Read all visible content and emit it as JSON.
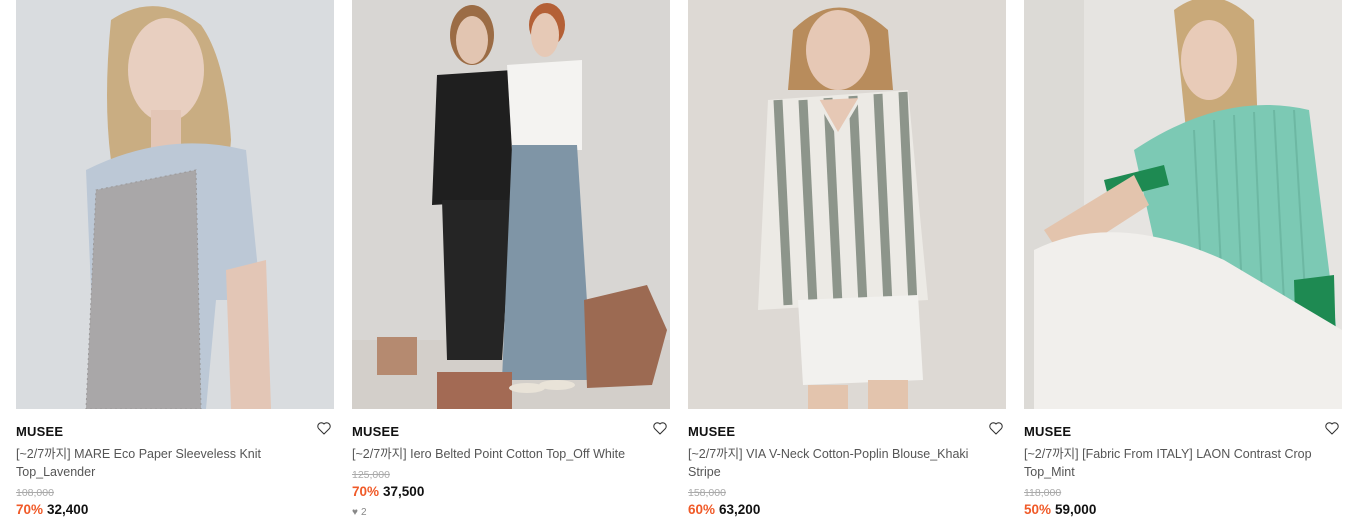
{
  "products": [
    {
      "brand": "MUSEE",
      "title": "[~2/7까지] MARE Eco Paper Sleeveless Knit Top_Lavender",
      "original_price": "108,000",
      "discount": "70%",
      "price": "32,400",
      "image_icon": "model-photo",
      "colors": {
        "bg": "#d9dcdf",
        "garment": "#a9a7a8",
        "tee": "#bcc8d6"
      }
    },
    {
      "brand": "MUSEE",
      "title": "[~2/7까지] Iero Belted Point Cotton Top_Off White",
      "original_price": "125,000",
      "discount": "70%",
      "price": "37,500",
      "likes": "2",
      "image_icon": "model-photo",
      "colors": {
        "bg": "#d8d6d3",
        "garment": "#1f1f1f",
        "skirt": "#7f95a6"
      }
    },
    {
      "brand": "MUSEE",
      "title": "[~2/7까지] VIA V-Neck Cotton-Poplin Blouse_Khaki Stripe",
      "original_price": "158,000",
      "discount": "60%",
      "price": "63,200",
      "image_icon": "model-photo",
      "colors": {
        "bg": "#ddd9d4",
        "garment": "#9ea59c",
        "shorts": "#f2f1ee"
      }
    },
    {
      "brand": "MUSEE",
      "title": "[~2/7까지] [Fabric From ITALY] LAON Contrast Crop Top_Mint",
      "original_price": "118,000",
      "discount": "50%",
      "price": "59,000",
      "image_icon": "model-photo",
      "colors": {
        "bg": "#e6e4e1",
        "garment": "#7cc9b4",
        "pants": "#f1efec"
      }
    }
  ]
}
